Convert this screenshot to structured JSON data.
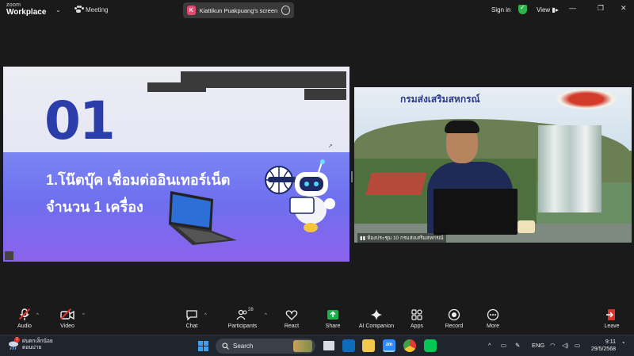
{
  "titlebar": {
    "brand_small": "zoom",
    "brand_main": "Workplace",
    "meeting_label": "Meeting",
    "share_initial": "K",
    "share_label": "Kiattikun Puakpuang's screen",
    "signin": "Sign in",
    "view": "View"
  },
  "slide": {
    "number": "01",
    "line1": "1.โน๊ตบุ๊ค เชื่อมต่ออินเทอร์เน็ต",
    "line2": "จำนวน 1 เครื่อง"
  },
  "camera": {
    "banner": "กรมส่งเสริมสหกรณ์",
    "participant": "ห้องประชุม 10 กรมส่งเสริมสหกรณ์"
  },
  "toolbar": {
    "audio": "Audio",
    "video": "Video",
    "chat": "Chat",
    "participants": "Participants",
    "participants_count": "28",
    "react": "React",
    "share": "Share",
    "ai": "AI Companion",
    "apps": "Apps",
    "record": "Record",
    "more": "More",
    "leave": "Leave"
  },
  "taskbar": {
    "weather_line1": "ฝนตกเล็กน้อย",
    "weather_line2": "ตอนบ่าย",
    "notification_count": "1",
    "search": "Search",
    "lang": "ENG",
    "time": "9:11",
    "date": "29/5/2568"
  },
  "colors": {
    "accent_green": "#2fb34b",
    "leave_red": "#e0302a",
    "share_green": "#1fae4c"
  }
}
